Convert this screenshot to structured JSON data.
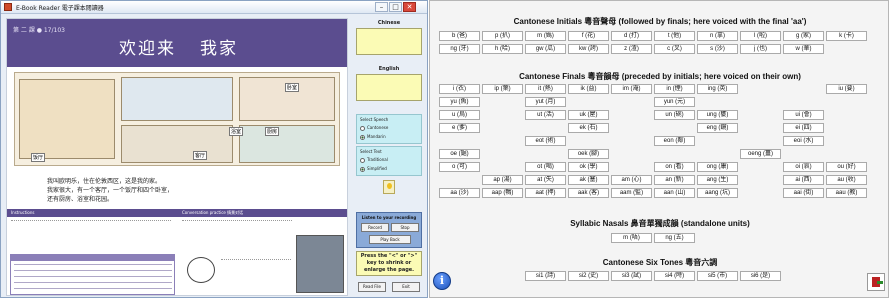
{
  "reader": {
    "title": "E-Book Reader 電子課本閱讀器",
    "window_buttons": {
      "minimize": "–",
      "maximize": "□",
      "close": "✕"
    },
    "page": {
      "lesson": "第 二 課  ● 17/103",
      "heading_left": "欢迎来",
      "heading_right": "我家",
      "room_tags": [
        "卧室",
        "厨房",
        "客厅",
        "浴室",
        "饭厅"
      ],
      "caption_lines": [
        "我叫欧明乐，住在伦敦西区，这是我的家。",
        "我家很大，有一个客厅，一个饭厅和四个卧室，",
        "还有厨房、浴室和花园。"
      ],
      "instructions_header_left": "Instructions",
      "instructions_header_right": "Conversation practice  情景对话",
      "vocab_title": "一般词汇表"
    },
    "side": {
      "chinese_label": "Chinese",
      "english_label": "English",
      "speech_title": "Select Speech",
      "speech_options": [
        "Cantonese",
        "Mandarin"
      ],
      "speech_selected": "Mandarin",
      "text_title": "Select Text",
      "text_options": [
        "Traditional",
        "Simplified"
      ],
      "text_selected": "Simplified",
      "record_title": "Listen to your recording",
      "record_label": "Record",
      "stop_label": "Stop",
      "play_label": "Play Back",
      "hint": "Press the \"<\" or \">\" key to shrink or enlarge the page.",
      "read_file_label": "Read File",
      "exit_label": "Exit"
    }
  },
  "chart": {
    "initials_title": "Cantonese Initials 粵音聲母 (followed by finals; here voiced with the final 'aa')",
    "initials_rows": [
      [
        "b (爸)",
        "p (扒)",
        "m (媽)",
        "f (花)",
        "d (打)",
        "t (他)",
        "n (拿)",
        "l (啦)",
        "g (家)",
        "k (卡)"
      ],
      [
        "ng (牙)",
        "h (哈)",
        "gw (瓜)",
        "kw (誇)",
        "z (渣)",
        "c (叉)",
        "s (沙)",
        "j (也)",
        "w (華)"
      ]
    ],
    "finals_title": "Cantonese Finals 粵音韻母 (preceded by initials; here voiced on their own)",
    "finals_grid": [
      [
        "i (衣)",
        "ip (葉)",
        "it (熱)",
        "ik (益)",
        "im (淹)",
        "in (煙)",
        "ing (英)",
        "",
        "",
        "iu (要)"
      ],
      [
        "yu (魚)",
        "",
        "yut (月)",
        "",
        "",
        "yun (元)",
        "",
        "",
        "",
        ""
      ],
      [
        "u (烏)",
        "",
        "ut (活)",
        "uk (屋)",
        "",
        "un (碗)",
        "ung (甕)",
        "",
        "ui (會)",
        ""
      ],
      [
        "e (爹)",
        "",
        "",
        "ek (石)",
        "",
        "",
        "eng (鏡)",
        "",
        "ei (四)",
        ""
      ],
      [
        "",
        "",
        "eot (術)",
        "",
        "",
        "eon (鄰)",
        "",
        "",
        "eoi (水)",
        ""
      ],
      [
        "oe (鋸)",
        "",
        "",
        "oek (腳)",
        "",
        "",
        "",
        "oeng (薑)",
        "",
        ""
      ],
      [
        "o (可)",
        "",
        "ot (喝)",
        "ok (學)",
        "",
        "on (看)",
        "ong (康)",
        "",
        "oi (哀)",
        "ou (好)"
      ],
      [
        "",
        "ap (湯)",
        "at (失)",
        "ak (塞)",
        "am (心)",
        "an (新)",
        "ang (生)",
        "",
        "ai (西)",
        "au (收)"
      ],
      [
        "aa (沙)",
        "aap (鴨)",
        "aat (押)",
        "aak (客)",
        "aam (監)",
        "aan (山)",
        "aang (坑)",
        "",
        "aai (街)",
        "aau (教)"
      ]
    ],
    "nasals_title": "Syllabic Nasals 鼻音單獨成韻 (standalone units)",
    "nasals": [
      "m (唔)",
      "ng (五)"
    ],
    "tones_title": "Cantonese Six Tones 粵音六調",
    "tones": [
      "si1 (詩)",
      "si2 (史)",
      "si3 (試)",
      "si4 (時)",
      "si5 (市)",
      "si6 (是)"
    ],
    "info_label": "i"
  }
}
